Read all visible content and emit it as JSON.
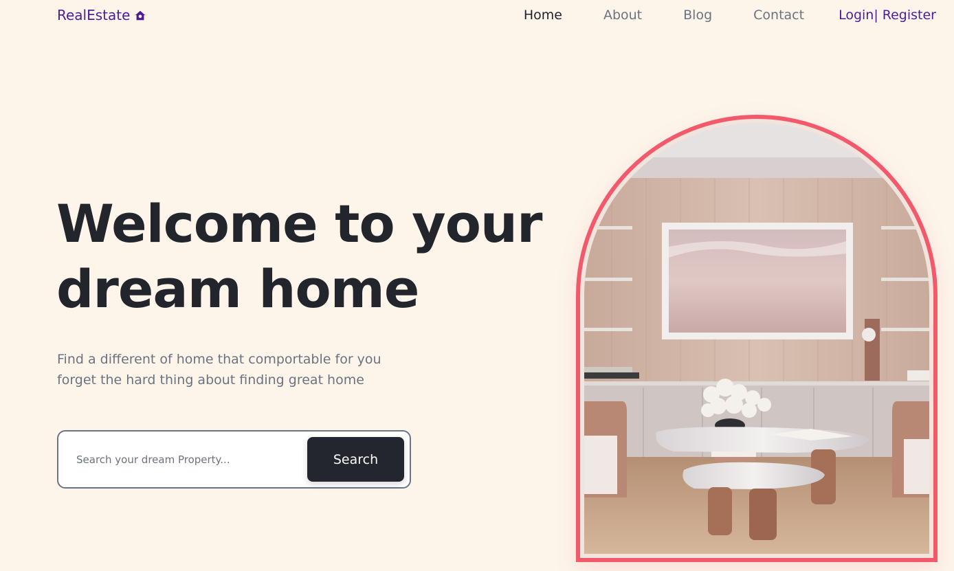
{
  "header": {
    "logo_text": "RealEstate",
    "logo_icon": "house-icon",
    "nav": [
      {
        "label": "Home",
        "active": true
      },
      {
        "label": "About",
        "active": false
      },
      {
        "label": "Blog",
        "active": false
      },
      {
        "label": "Contact",
        "active": false
      }
    ],
    "auth_label": "Login| Register"
  },
  "hero": {
    "title_line1": "Welcome to your",
    "title_line2": "dream home",
    "subtitle_line1": "Find a different of home that comportable for you",
    "subtitle_line2": "forget the hard thing about finding great home",
    "search": {
      "placeholder": "Search your dream Property...",
      "value": "",
      "button_label": "Search"
    }
  },
  "colors": {
    "background": "#fdf5ea",
    "brand": "#4c1d95",
    "accent": "#f25a6b",
    "dark": "#24262f",
    "muted": "#6b7280"
  }
}
